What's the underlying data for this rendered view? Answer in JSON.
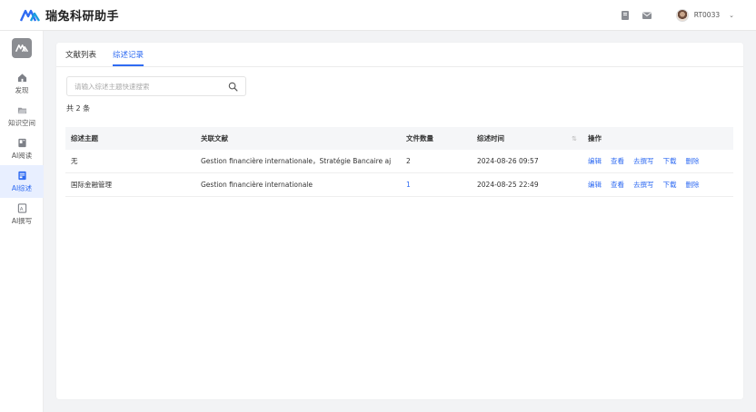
{
  "app": {
    "title": "瑞兔科研助手"
  },
  "header": {
    "username": "RT0033",
    "icons": [
      "book-icon",
      "mail-icon"
    ]
  },
  "sidebar": {
    "items": [
      {
        "label": "发现",
        "icon": "home-icon",
        "active": false
      },
      {
        "label": "知识空间",
        "icon": "folder-icon",
        "active": false
      },
      {
        "label": "AI阅读",
        "icon": "reading-icon",
        "active": false
      },
      {
        "label": "AI综述",
        "icon": "review-icon",
        "active": true
      },
      {
        "label": "AI撰写",
        "icon": "writing-icon",
        "active": false
      }
    ]
  },
  "tabs": [
    {
      "label": "文献列表",
      "active": false
    },
    {
      "label": "综述记录",
      "active": true
    }
  ],
  "search": {
    "placeholder": "请输入综述主题快速搜索",
    "value": ""
  },
  "total": "共 2 条",
  "table": {
    "headers": [
      "综述主题",
      "关联文献",
      "文件数量",
      "综述时间",
      "操作"
    ],
    "rows": [
      {
        "topic": "无",
        "refs": "Gestion financière internationale，Stratégie Bancaire aj",
        "count": "2",
        "time": "2024-08-26 09:57"
      },
      {
        "topic": "国际金融管理",
        "refs": "Gestion financière internationale",
        "count": "1",
        "time": "2024-08-25 22:49"
      }
    ],
    "actions": [
      "编辑",
      "查看",
      "去撰写",
      "下载",
      "删除"
    ]
  },
  "colors": {
    "accent": "#2f6bf2",
    "active_bg": "#e8efff"
  }
}
